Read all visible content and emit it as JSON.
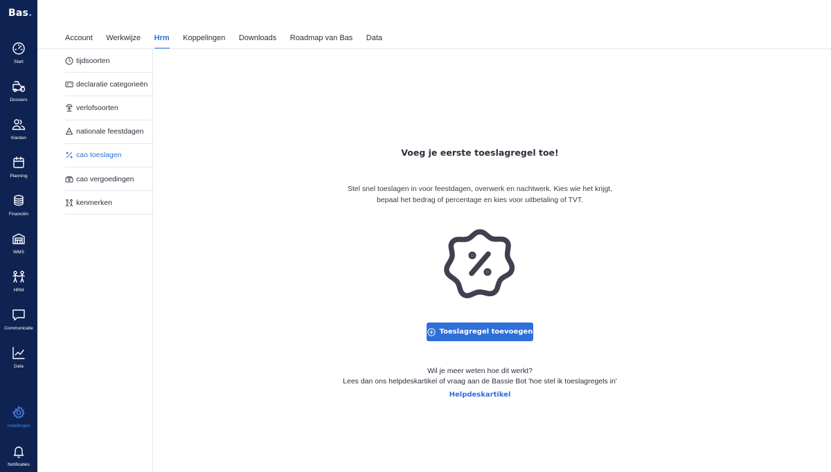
{
  "app": {
    "logo_text": "Bas",
    "logo_dot": "."
  },
  "rail": {
    "items": [
      {
        "label": "Start",
        "icon": "speedometer-icon"
      },
      {
        "label": "Dossiers",
        "icon": "truck-icon"
      },
      {
        "label": "Klanten",
        "icon": "people-icon"
      },
      {
        "label": "Planning",
        "icon": "calendar-icon"
      },
      {
        "label": "Financiën",
        "icon": "coins-icon"
      },
      {
        "label": "WMS",
        "icon": "warehouse-icon"
      },
      {
        "label": "HRM",
        "icon": "hrm-people-icon"
      },
      {
        "label": "Communicatie",
        "icon": "chat-icon"
      },
      {
        "label": "Data",
        "icon": "line-chart-icon"
      },
      {
        "label": "Instellingen",
        "icon": "gear-icon",
        "active": true
      },
      {
        "label": "Notificaties",
        "icon": "bell-icon"
      }
    ]
  },
  "tabs": [
    {
      "label": "Account"
    },
    {
      "label": "Werkwijze"
    },
    {
      "label": "Hrm",
      "active": true
    },
    {
      "label": "Koppelingen"
    },
    {
      "label": "Downloads"
    },
    {
      "label": "Roadmap van Bas"
    },
    {
      "label": "Data"
    }
  ],
  "submenu": [
    {
      "label": "tijdsoorten",
      "icon": "clock-icon"
    },
    {
      "label": "declaratie categorieën",
      "icon": "receipt-icon"
    },
    {
      "label": "verlofsoorten",
      "icon": "beach-umbrella-icon"
    },
    {
      "label": "nationale feestdagen",
      "icon": "tree-icon"
    },
    {
      "label": "cao toeslagen",
      "icon": "percent-icon",
      "active": true
    },
    {
      "label": "cao vergoedingen",
      "icon": "money-icon"
    },
    {
      "label": "kenmerken",
      "icon": "traits-icon"
    }
  ],
  "empty_state": {
    "title": "Voeg je eerste toeslagregel toe!",
    "desc_line1": "Stel snel toeslagen in voor feestdagen, overwerk en nachtwerk. Kies wie het krijgt,",
    "desc_line2": "bepaal het bedrag of percentage en kies voor uitbetaling of TVT.",
    "badge_icon": "percent-badge-icon",
    "cta_label": "Toeslagregel toevoegen",
    "help_line1": "Wil je meer weten hoe dit werkt?",
    "help_line2": "Lees dan ons helpdeskartikel of vraag aan de Bassie Bot 'hoe stel ik toeslagregels in'",
    "help_link": "Helpdeskartikel"
  },
  "colors": {
    "rail_bg": "#0f2352",
    "accent": "#2e6fd8",
    "text": "#2d2e3b",
    "divider": "#e6e7ec"
  }
}
